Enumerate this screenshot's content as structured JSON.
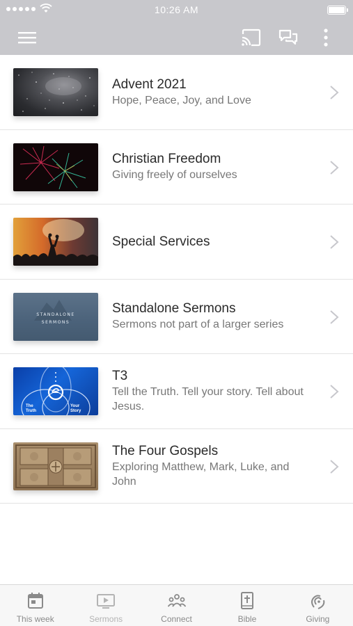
{
  "status_bar": {
    "time": "10:26 AM"
  },
  "app_bar": {
    "icons": [
      "menu-icon",
      "cast-icon",
      "chat-icon",
      "more-vertical-icon"
    ]
  },
  "series": [
    {
      "title": "Advent 2021",
      "subtitle": "Hope, Peace, Joy, and Love"
    },
    {
      "title": "Christian Freedom",
      "subtitle": "Giving freely of ourselves"
    },
    {
      "title": "Special Services",
      "subtitle": ""
    },
    {
      "title": "Standalone Sermons",
      "subtitle": "Sermons not part of a larger series",
      "thumb_text": [
        "STANDALONE",
        "SERMONS"
      ]
    },
    {
      "title": "T3",
      "subtitle": "Tell the Truth. Tell your story. Tell about Jesus.",
      "thumb_text": [
        "The",
        "Truth",
        "Your",
        "Story"
      ]
    },
    {
      "title": "The Four Gospels",
      "subtitle": "Exploring Matthew, Mark, Luke, and John"
    }
  ],
  "tab_bar": {
    "tabs": [
      {
        "label": "This week",
        "icon": "calendar-icon"
      },
      {
        "label": "Sermons",
        "icon": "tv-play-icon"
      },
      {
        "label": "Connect",
        "icon": "people-icon"
      },
      {
        "label": "Bible",
        "icon": "bible-icon"
      },
      {
        "label": "Giving",
        "icon": "giving-icon"
      }
    ]
  },
  "colors": {
    "app_bar": "#c8c8cc",
    "accent": "#2b2b2b",
    "secondary_text": "#777777"
  }
}
